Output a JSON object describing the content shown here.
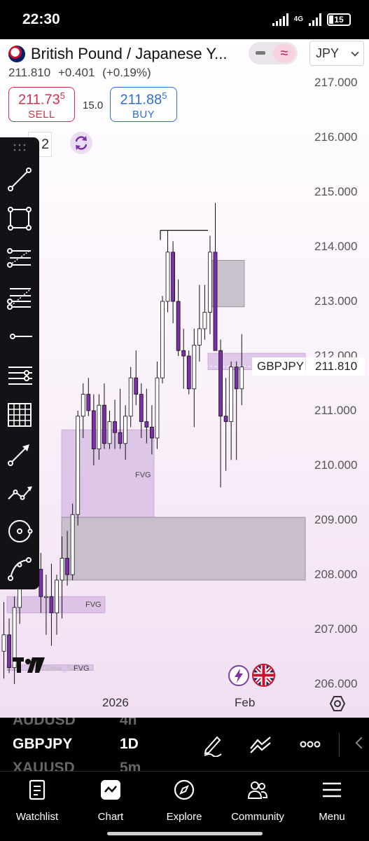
{
  "status_bar": {
    "time": "22:30",
    "network": "4G",
    "battery": "15"
  },
  "header": {
    "symbol_title": "British Pound / Japanese Y...",
    "last_price": "211.810",
    "change": "+0.401",
    "change_percent": "(+0.19%)",
    "currency": "JPY"
  },
  "trade": {
    "sell_price_main": "211.73",
    "sell_price_sup": "5",
    "sell_label": "SELL",
    "spread": "15.0",
    "buy_price_main": "211.88",
    "buy_price_sup": "5",
    "buy_label": "BUY",
    "quantity": "2"
  },
  "chart_data": {
    "type": "candlestick",
    "symbol": "GBPJPY",
    "current_price": "211.810",
    "price_ticks": [
      "217.000",
      "216.000",
      "215.000",
      "214.000",
      "213.000",
      "212.000",
      "211.000",
      "210.000",
      "209.000",
      "208.000",
      "207.000",
      "206.000"
    ],
    "time_labels": [
      "2026",
      "Feb"
    ],
    "ylim": [
      206,
      217
    ],
    "candles": [
      {
        "o": 206.6,
        "h": 207.5,
        "l": 206.1,
        "c": 206.9
      },
      {
        "o": 206.9,
        "h": 207.2,
        "l": 206.2,
        "c": 206.3
      },
      {
        "o": 206.3,
        "h": 207.6,
        "l": 206.0,
        "c": 207.4
      },
      {
        "o": 207.4,
        "h": 208.4,
        "l": 207.1,
        "c": 208.2
      },
      {
        "o": 208.2,
        "h": 208.9,
        "l": 207.8,
        "c": 208.6
      },
      {
        "o": 208.6,
        "h": 209.2,
        "l": 208.1,
        "c": 208.4
      },
      {
        "o": 208.4,
        "h": 209.0,
        "l": 207.9,
        "c": 208.1
      },
      {
        "o": 208.1,
        "h": 208.4,
        "l": 207.3,
        "c": 207.6
      },
      {
        "o": 207.6,
        "h": 208.0,
        "l": 206.9,
        "c": 207.6
      },
      {
        "o": 207.6,
        "h": 208.2,
        "l": 206.7,
        "c": 207.3
      },
      {
        "o": 207.3,
        "h": 208.0,
        "l": 206.9,
        "c": 207.9
      },
      {
        "o": 207.9,
        "h": 208.7,
        "l": 207.2,
        "c": 208.3
      },
      {
        "o": 208.3,
        "h": 208.8,
        "l": 207.8,
        "c": 208.0
      },
      {
        "o": 208.0,
        "h": 209.3,
        "l": 207.9,
        "c": 209.1
      },
      {
        "o": 209.1,
        "h": 211.0,
        "l": 208.9,
        "c": 210.9
      },
      {
        "o": 210.9,
        "h": 211.5,
        "l": 210.5,
        "c": 211.3
      },
      {
        "o": 211.3,
        "h": 211.6,
        "l": 210.9,
        "c": 211.0
      },
      {
        "o": 211.0,
        "h": 211.3,
        "l": 210.0,
        "c": 210.3
      },
      {
        "o": 210.3,
        "h": 211.3,
        "l": 210.1,
        "c": 211.1
      },
      {
        "o": 211.1,
        "h": 211.5,
        "l": 210.3,
        "c": 210.4
      },
      {
        "o": 210.4,
        "h": 211.0,
        "l": 210.3,
        "c": 210.8
      },
      {
        "o": 210.8,
        "h": 211.2,
        "l": 210.3,
        "c": 210.6
      },
      {
        "o": 210.6,
        "h": 211.4,
        "l": 210.3,
        "c": 210.4
      },
      {
        "o": 210.4,
        "h": 211.1,
        "l": 210.1,
        "c": 210.9
      },
      {
        "o": 210.9,
        "h": 211.8,
        "l": 210.7,
        "c": 211.6
      },
      {
        "o": 211.6,
        "h": 212.1,
        "l": 211.1,
        "c": 211.3
      },
      {
        "o": 211.3,
        "h": 211.5,
        "l": 210.5,
        "c": 210.8
      },
      {
        "o": 210.8,
        "h": 211.4,
        "l": 210.4,
        "c": 210.7
      },
      {
        "o": 210.7,
        "h": 211.1,
        "l": 210.2,
        "c": 210.5
      },
      {
        "o": 210.5,
        "h": 211.9,
        "l": 210.3,
        "c": 211.6
      },
      {
        "o": 211.6,
        "h": 213.1,
        "l": 211.5,
        "c": 213.0
      },
      {
        "o": 213.0,
        "h": 214.3,
        "l": 212.8,
        "c": 213.9
      },
      {
        "o": 213.9,
        "h": 214.1,
        "l": 212.6,
        "c": 213.0
      },
      {
        "o": 213.0,
        "h": 213.4,
        "l": 212.0,
        "c": 212.1
      },
      {
        "o": 212.1,
        "h": 212.5,
        "l": 211.4,
        "c": 212.0
      },
      {
        "o": 212.0,
        "h": 212.1,
        "l": 211.3,
        "c": 211.4
      },
      {
        "o": 211.4,
        "h": 212.5,
        "l": 210.7,
        "c": 212.2
      },
      {
        "o": 212.2,
        "h": 213.3,
        "l": 211.9,
        "c": 212.5
      },
      {
        "o": 212.5,
        "h": 213.3,
        "l": 212.3,
        "c": 212.8
      },
      {
        "o": 212.8,
        "h": 214.2,
        "l": 212.4,
        "c": 213.9
      },
      {
        "o": 213.9,
        "h": 214.8,
        "l": 212.7,
        "c": 212.1
      },
      {
        "o": 212.1,
        "h": 212.3,
        "l": 209.6,
        "c": 210.9
      },
      {
        "o": 210.9,
        "h": 211.6,
        "l": 209.9,
        "c": 210.8
      },
      {
        "o": 210.8,
        "h": 211.9,
        "l": 210.1,
        "c": 211.8
      },
      {
        "o": 211.8,
        "h": 211.9,
        "l": 210.1,
        "c": 211.4
      },
      {
        "o": 211.4,
        "h": 212.4,
        "l": 211.1,
        "c": 211.8
      }
    ],
    "zones": [
      {
        "label": "FVG",
        "y_top": 210.65,
        "y_bottom": 209.05,
        "kind": "fvg"
      },
      {
        "label": "",
        "y_top": 209.05,
        "y_bottom": 207.9,
        "kind": "supply"
      },
      {
        "label": "FVG",
        "y_top": 207.6,
        "y_bottom": 207.3,
        "kind": "fvg"
      },
      {
        "label": "",
        "y_top": 213.75,
        "y_bottom": 212.9,
        "kind": "supply"
      },
      {
        "label": "",
        "y_top": 212.05,
        "y_bottom": 211.75,
        "kind": "fvg"
      },
      {
        "label": "FVG",
        "y_top": 206.35,
        "y_bottom": 206.25,
        "kind": "fvg"
      }
    ],
    "high_line": 214.3
  },
  "labels": {
    "fvg_1": "FVG",
    "fvg_2": "FVG",
    "fvg_3": "FVG",
    "watermark": "Ghew_Sa..."
  },
  "drawing_tools": [
    "trend-line-icon",
    "rectangle-icon",
    "fib-retracement-icon",
    "fib-extension-icon",
    "horizontal-ray-icon",
    "parallel-lines-icon",
    "grid-icon",
    "arrow-line-icon",
    "path-icon",
    "circle-target-icon",
    "curve-icon"
  ],
  "watchlist": [
    {
      "symbol": "AUDUSD",
      "timeframe": "4h"
    },
    {
      "symbol": "GBPJPY",
      "timeframe": "1D"
    },
    {
      "symbol": "XAUUSD",
      "timeframe": "5m"
    }
  ],
  "nav": [
    {
      "label": "Watchlist",
      "icon": "watchlist-icon"
    },
    {
      "label": "Chart",
      "icon": "chart-icon"
    },
    {
      "label": "Explore",
      "icon": "compass-icon"
    },
    {
      "label": "Community",
      "icon": "community-icon"
    },
    {
      "label": "Menu",
      "icon": "menu-icon"
    }
  ],
  "colors": {
    "bull_fill": "#ffffff",
    "bear_fill": "#7b2fa8",
    "candle_stroke": "#111111",
    "fvg_fill": "#d5b8e2",
    "supply_fill": "#b9b0bd",
    "sell": "#d32f4f",
    "buy": "#2f6fd3"
  }
}
